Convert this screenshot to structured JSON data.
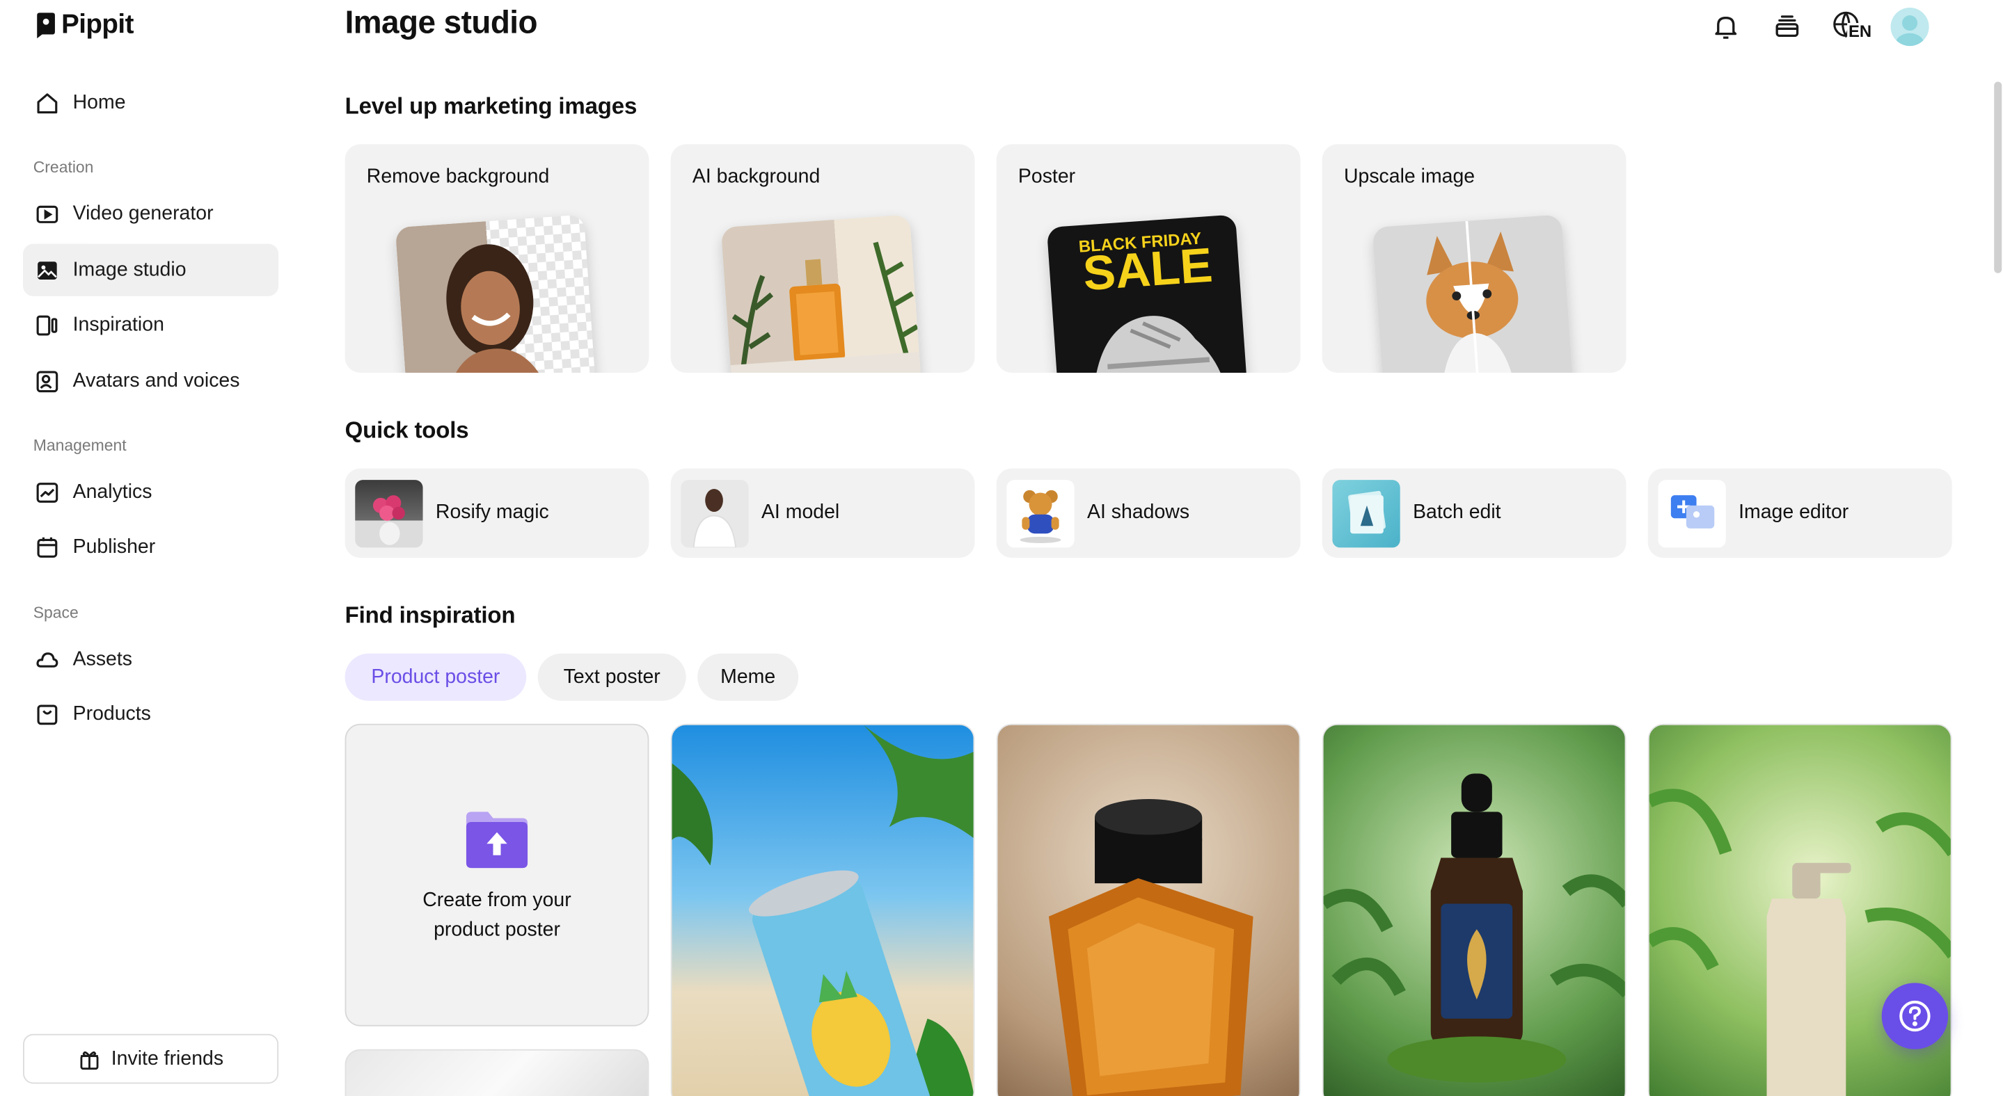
{
  "app": {
    "name": "Pippit"
  },
  "sidebar": {
    "home": "Home",
    "sections": {
      "creation": "Creation",
      "management": "Management",
      "space": "Space"
    },
    "items": [
      {
        "label": "Video generator",
        "icon": "video-generator-icon"
      },
      {
        "label": "Image studio",
        "icon": "image-studio-icon",
        "active": true
      },
      {
        "label": "Inspiration",
        "icon": "inspiration-icon"
      },
      {
        "label": "Avatars and voices",
        "icon": "avatar-voice-icon"
      },
      {
        "label": "Analytics",
        "icon": "analytics-icon"
      },
      {
        "label": "Publisher",
        "icon": "calendar-icon"
      },
      {
        "label": "Assets",
        "icon": "cloud-icon"
      },
      {
        "label": "Products",
        "icon": "products-icon"
      }
    ],
    "invite": "Invite friends"
  },
  "header": {
    "title": "Image studio",
    "language": "EN"
  },
  "level_up": {
    "heading": "Level up marketing images",
    "cards": [
      {
        "label": "Remove background"
      },
      {
        "label": "AI background"
      },
      {
        "label": "Poster",
        "poster_text_1": "BLACK FRIDAY",
        "poster_text_2": "SALE"
      },
      {
        "label": "Upscale image"
      }
    ]
  },
  "quick_tools": {
    "heading": "Quick tools",
    "tools": [
      {
        "label": "Rosify magic"
      },
      {
        "label": "AI model"
      },
      {
        "label": "AI shadows"
      },
      {
        "label": "Batch edit"
      },
      {
        "label": "Image editor"
      }
    ]
  },
  "inspiration": {
    "heading": "Find inspiration",
    "tabs": [
      {
        "label": "Product poster",
        "active": true
      },
      {
        "label": "Text poster"
      },
      {
        "label": "Meme"
      }
    ],
    "create_card": "Create from your product poster"
  },
  "colors": {
    "accent": "#6a4ee8",
    "active_pill_bg": "#ece8ff",
    "card_bg": "#f2f2f2"
  }
}
